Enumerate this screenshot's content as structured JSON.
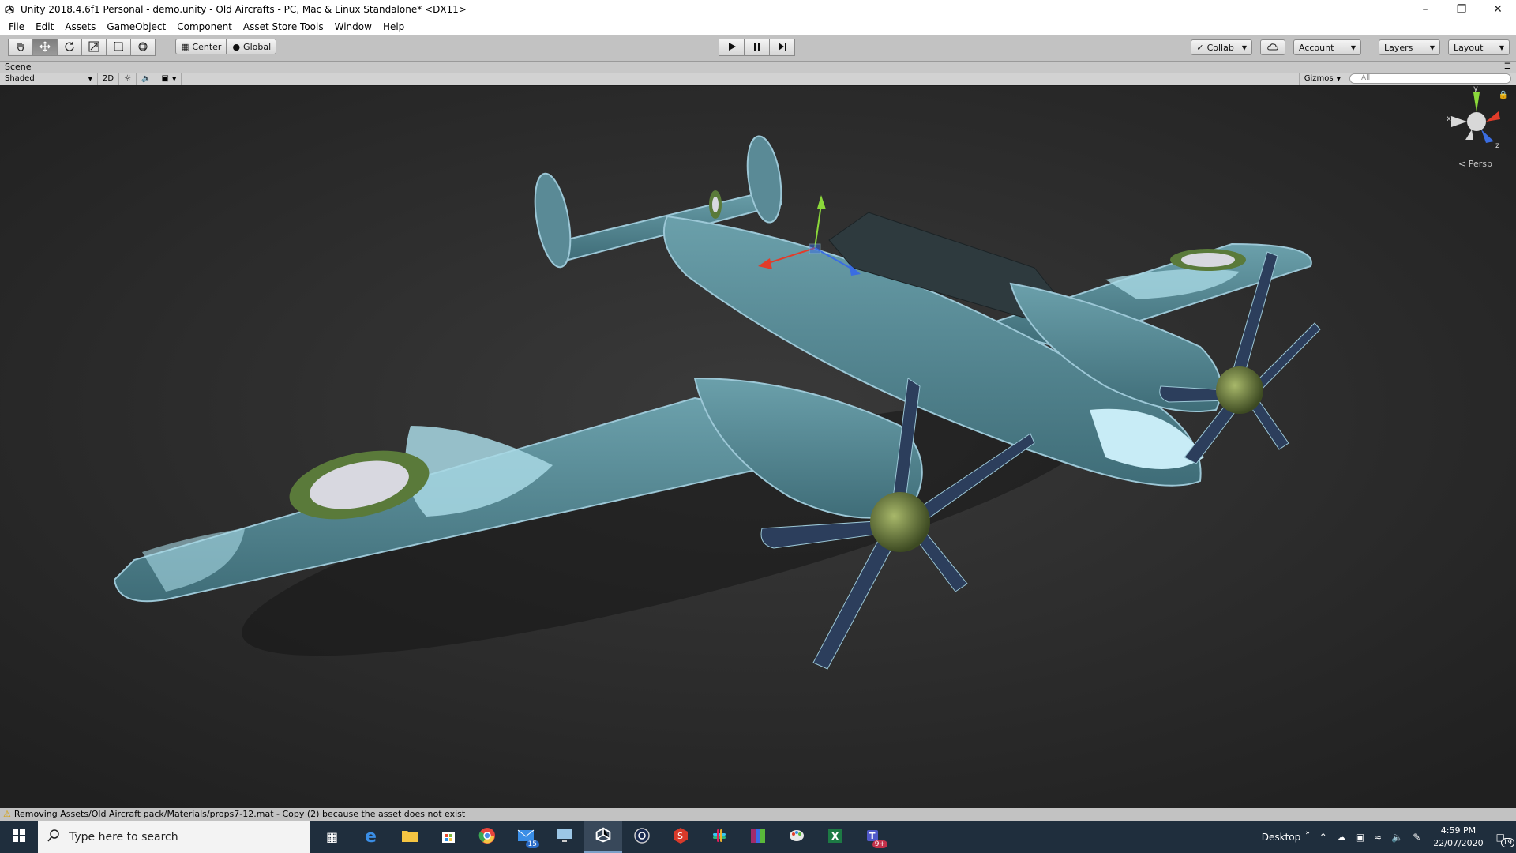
{
  "window": {
    "title": "Unity 2018.4.6f1 Personal - demo.unity - Old Aircrafts - PC, Mac & Linux Standalone* <DX11>"
  },
  "menu": [
    "File",
    "Edit",
    "Assets",
    "GameObject",
    "Component",
    "Asset Store Tools",
    "Window",
    "Help"
  ],
  "toolbar": {
    "pivot_label": "Center",
    "space_label": "Global",
    "collab_label": "Collab",
    "account_label": "Account",
    "layers_label": "Layers",
    "layout_label": "Layout"
  },
  "scene": {
    "tab_label": "Scene",
    "shading_mode": "Shaded",
    "mode_2d": "2D",
    "gizmos_label": "Gizmos",
    "search_placeholder": "All",
    "persp_label": "Persp",
    "axis_x": "x",
    "axis_y": "y",
    "axis_z": "z"
  },
  "status": {
    "message": "Removing Assets/Old Aircraft pack/Materials/props7-12.mat - Copy (2) because the asset does not exist"
  },
  "taskbar": {
    "search_placeholder": "Type here to search",
    "desktop_label": "Desktop",
    "time": "4:59 PM",
    "date": "22/07/2020",
    "mail_badge": "15",
    "teams_badge": "9+",
    "notification_count": "19"
  },
  "colors": {
    "viewport_bg": "#232323",
    "aircraft_body": "#4f7f8a",
    "aircraft_camo": "#a8d8e4",
    "roundel_outer": "#5a7a3a",
    "taskbar_bg": "#1f2e3d"
  }
}
